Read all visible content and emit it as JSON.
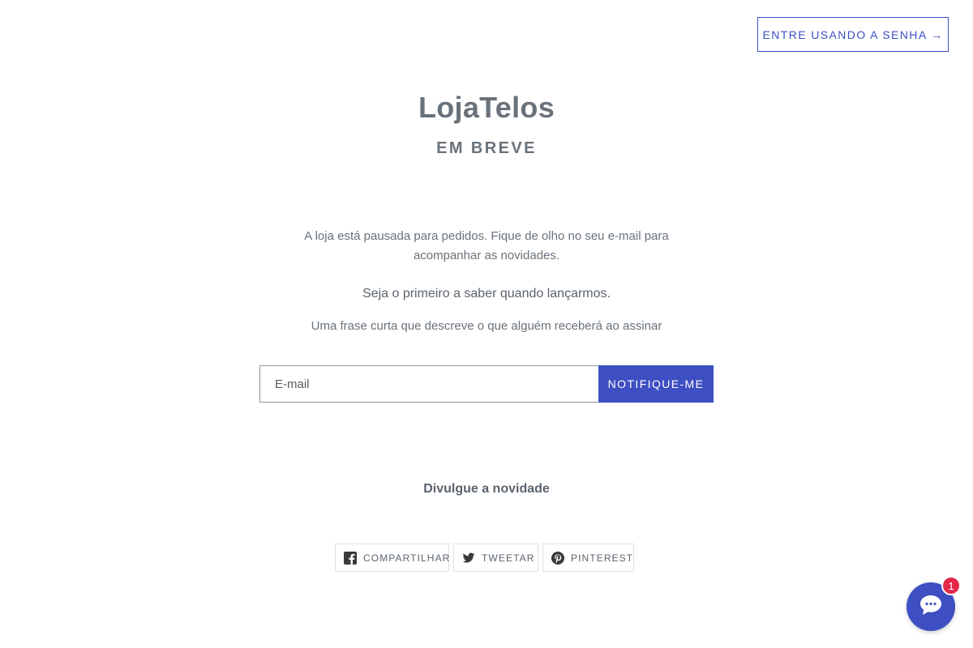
{
  "header": {
    "password_link": "ENTRE USANDO A SENHA →"
  },
  "brand": {
    "store_name": "LojaTelos",
    "status": "EM BREVE"
  },
  "content": {
    "intro": "A loja está pausada para pedidos. Fique de olho no seu e-mail para acompanhar as novidades.",
    "lead": "Seja o primeiro a saber quando lançarmos.",
    "sub": "Uma frase curta que descreve o que alguém receberá ao assinar"
  },
  "signup": {
    "email_placeholder": "E-mail",
    "email_value": "",
    "submit_label": "NOTIFIQUE-ME"
  },
  "share": {
    "title": "Divulgue a novidade",
    "buttons": [
      {
        "label": "COMPARTILHAR",
        "icon": "facebook-icon"
      },
      {
        "label": "TWEETAR",
        "icon": "twitter-icon"
      },
      {
        "label": "PINTEREST",
        "icon": "pinterest-icon"
      }
    ]
  },
  "chat": {
    "icon": "chat-bubble-icon",
    "badge_count": "1"
  },
  "colors": {
    "accent": "#3d4fc2",
    "text": "#69727b",
    "badge": "#e4274a"
  }
}
